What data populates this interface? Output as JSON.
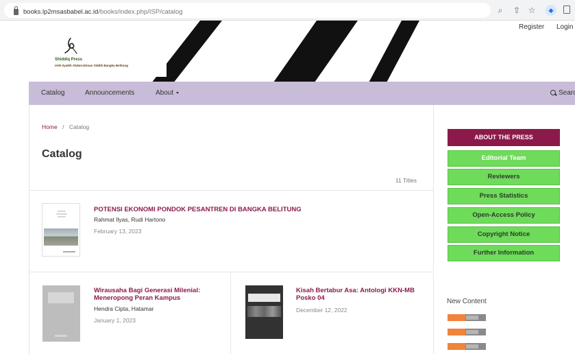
{
  "browser": {
    "url_host": "books.lp2msasbabel.ac.id",
    "url_path": "/books/index.php/ISP/catalog",
    "icons": [
      "lock-icon",
      "zoom-icon",
      "share-icon",
      "star-icon",
      "extension-icon",
      "sidebar-icon"
    ]
  },
  "header": {
    "logo_name": "Shiddiq Press",
    "logo_sub": "IAIN Syaikh Abdurrahman Siddik Bangka Belitung",
    "register": "Register",
    "login": "Login"
  },
  "nav": {
    "catalog": "Catalog",
    "announcements": "Announcements",
    "about": "About",
    "search": "Search"
  },
  "breadcrumb": {
    "home": "Home",
    "separator": "/",
    "current": "Catalog"
  },
  "main": {
    "title": "Catalog",
    "count": "11 Titles",
    "books": [
      {
        "title": "POTENSI EKONOMI PONDOK PESANTREN DI BANGKA BELITUNG",
        "authors": "Rahmat Ilyas, Rudi Hartono",
        "date": "February 13, 2023"
      },
      {
        "title_line1": "Wirausaha Bagi Generasi Milenial:",
        "title_line2": "Meneropong Peran Kampus",
        "authors": "Hendra Cipta, Hatamar",
        "date": "January 1, 2023"
      },
      {
        "title_line1": "Kisah Bertabur Asa: Antologi KKN-MB",
        "title_line2": "Posko 04",
        "date": "December 12, 2022"
      }
    ]
  },
  "sidebar": {
    "about_press": "ABOUT THE PRESS",
    "buttons": [
      "Editorial Team",
      "Reviewers",
      "Press Statistics",
      "Open-Access Policy",
      "Copyright Notice",
      "Further Information"
    ],
    "new_content": "New Content"
  },
  "colors": {
    "nav_bg": "#c9bcd8",
    "accent": "#8b1a4a",
    "green_button": "#6fdb5a"
  }
}
